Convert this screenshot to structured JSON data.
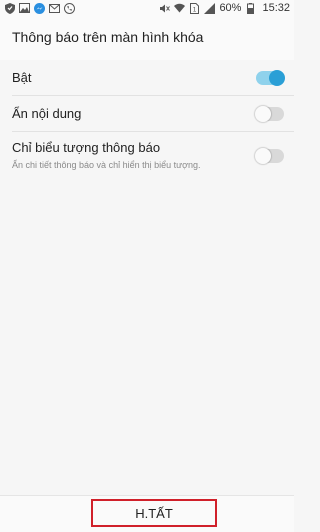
{
  "status_bar": {
    "left_icons": [
      "shield-icon",
      "image-icon",
      "messenger-icon",
      "mail-icon",
      "phone-icon"
    ],
    "right_icons": [
      "mute-icon",
      "wifi-icon",
      "sim-icon",
      "signal-icon",
      "battery-icon"
    ],
    "battery": "60%",
    "time": "15:32"
  },
  "header": {
    "title": "Thông báo trên màn hình khóa"
  },
  "settings": {
    "items": [
      {
        "label": "Bật",
        "sublabel": "",
        "toggle": "on"
      },
      {
        "label": "Ẩn nội dung",
        "sublabel": "",
        "toggle": "off"
      },
      {
        "label": "Chỉ biểu tượng thông báo",
        "sublabel": "Ẩn chi tiết thông báo và chỉ hiển thị biểu tượng.",
        "toggle": "off"
      }
    ]
  },
  "footer": {
    "done_label": "H.TẤT"
  },
  "colors": {
    "accent": "#2a9fd6",
    "accent_track": "#8fd2ec",
    "highlight_border": "#d0202a"
  }
}
